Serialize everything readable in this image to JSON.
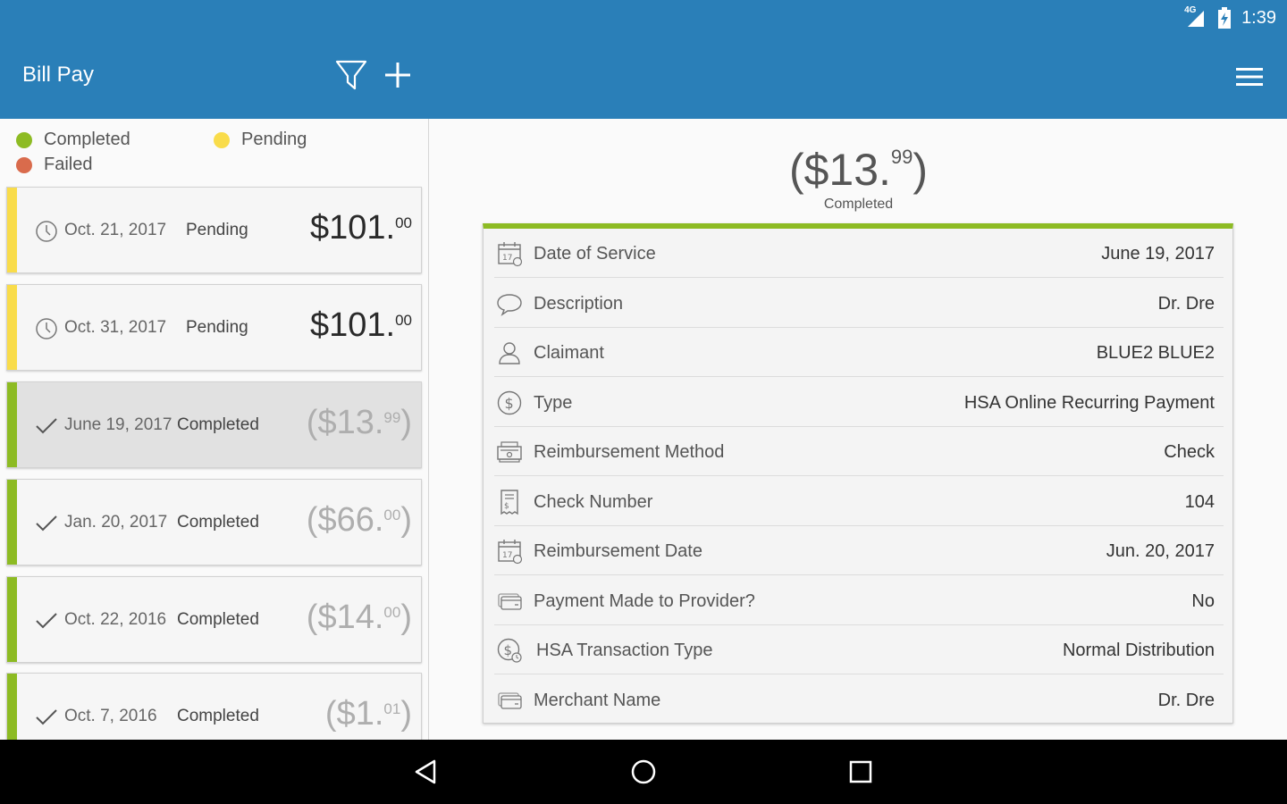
{
  "status_bar": {
    "network": "4G",
    "time": "1:39"
  },
  "app_bar": {
    "title": "Bill Pay"
  },
  "legend": {
    "completed": "Completed",
    "pending": "Pending",
    "failed": "Failed"
  },
  "colors": {
    "completed": "#8dbb23",
    "pending": "#f9dc4a",
    "failed": "#d96b4c",
    "brand": "#2a7fb8"
  },
  "transactions": [
    {
      "date": "Oct. 21, 2017",
      "status": "Pending",
      "amount_prefix": "$",
      "amount_whole": "101.",
      "amount_cents": "00",
      "amount_suffix": "",
      "icon": "clock-icon"
    },
    {
      "date": "Oct. 31, 2017",
      "status": "Pending",
      "amount_prefix": "$",
      "amount_whole": "101.",
      "amount_cents": "00",
      "amount_suffix": "",
      "icon": "clock-icon"
    },
    {
      "date": "June 19, 2017",
      "status": "Completed",
      "amount_prefix": "($",
      "amount_whole": "13.",
      "amount_cents": "99",
      "amount_suffix": ")",
      "icon": "checkmark-icon",
      "selected": true
    },
    {
      "date": "Jan. 20, 2017",
      "status": "Completed",
      "amount_prefix": "($",
      "amount_whole": "66.",
      "amount_cents": "00",
      "amount_suffix": ")",
      "icon": "checkmark-icon"
    },
    {
      "date": "Oct. 22, 2016",
      "status": "Completed",
      "amount_prefix": "($",
      "amount_whole": "14.",
      "amount_cents": "00",
      "amount_suffix": ")",
      "icon": "checkmark-icon"
    },
    {
      "date": "Oct. 7, 2016",
      "status": "Completed",
      "amount_prefix": "($",
      "amount_whole": "1.",
      "amount_cents": "01",
      "amount_suffix": ")",
      "icon": "checkmark-icon"
    }
  ],
  "detail": {
    "amount_main": "($13.",
    "amount_cents": "99",
    "amount_close": ")",
    "status": "Completed",
    "rows": [
      {
        "label": "Date of Service",
        "value": "June 19, 2017",
        "icon": "calendar-icon"
      },
      {
        "label": "Description",
        "value": "Dr. Dre",
        "icon": "speech-bubble-icon"
      },
      {
        "label": "Claimant",
        "value": "BLUE2 BLUE2",
        "icon": "person-icon"
      },
      {
        "label": "Type",
        "value": "HSA Online Recurring Payment",
        "icon": "dollar-circle-icon"
      },
      {
        "label": "Reimbursement Method",
        "value": "Check",
        "icon": "cash-register-icon"
      },
      {
        "label": "Check Number",
        "value": "104",
        "icon": "receipt-icon"
      },
      {
        "label": "Reimbursement Date",
        "value": "Jun. 20, 2017",
        "icon": "calendar-icon"
      },
      {
        "label": "Payment Made to Provider?",
        "value": "No",
        "icon": "card-icon"
      },
      {
        "label": "HSA Transaction Type",
        "value": "Normal Distribution",
        "icon": "dollar-clock-icon"
      },
      {
        "label": "Merchant Name",
        "value": "Dr. Dre",
        "icon": "card-icon"
      }
    ]
  }
}
